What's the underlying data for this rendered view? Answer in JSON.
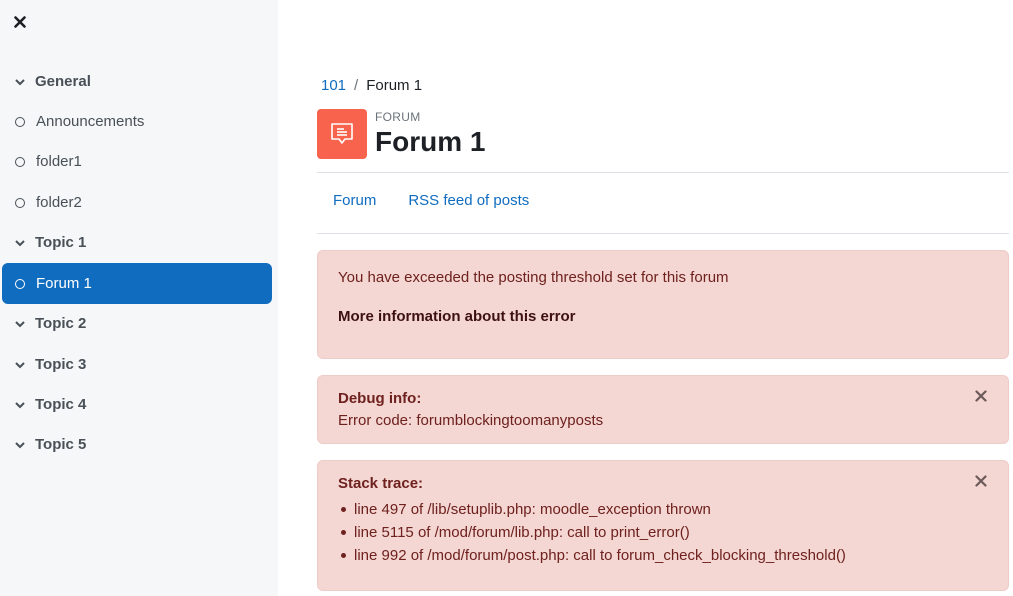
{
  "sidebar": {
    "close_icon": "close-icon",
    "items": [
      {
        "label": "General",
        "type": "section"
      },
      {
        "label": "Announcements",
        "type": "activity"
      },
      {
        "label": "folder1",
        "type": "activity"
      },
      {
        "label": "folder2",
        "type": "activity"
      },
      {
        "label": "Topic 1",
        "type": "section"
      },
      {
        "label": "Forum 1",
        "type": "activity",
        "active": true
      },
      {
        "label": "Topic 2",
        "type": "section"
      },
      {
        "label": "Topic 3",
        "type": "section"
      },
      {
        "label": "Topic 4",
        "type": "section"
      },
      {
        "label": "Topic 5",
        "type": "section"
      }
    ]
  },
  "breadcrumb": {
    "course": "101",
    "separator": "/",
    "current": "Forum 1"
  },
  "header": {
    "module_type": "FORUM",
    "title": "Forum 1",
    "icon": "forum-icon",
    "icon_bg": "#f7634d"
  },
  "tabs": [
    {
      "label": "Forum"
    },
    {
      "label": "RSS feed of posts"
    }
  ],
  "error": {
    "message": "You have exceeded the posting threshold set for this forum",
    "more_info": "More information about this error"
  },
  "debug": {
    "title": "Debug info:",
    "code": "Error code: forumblockingtoomanyposts"
  },
  "stack": {
    "title": "Stack trace:",
    "lines": [
      "line 497 of /lib/setuplib.php: moodle_exception thrown",
      "line 5115 of /mod/forum/lib.php: call to print_error()",
      "line 992 of /mod/forum/post.php: call to forum_check_blocking_threshold()"
    ]
  },
  "colors": {
    "accent": "#0f6cbf",
    "alert_bg": "#f4d6d2",
    "alert_text": "#6e211e"
  }
}
